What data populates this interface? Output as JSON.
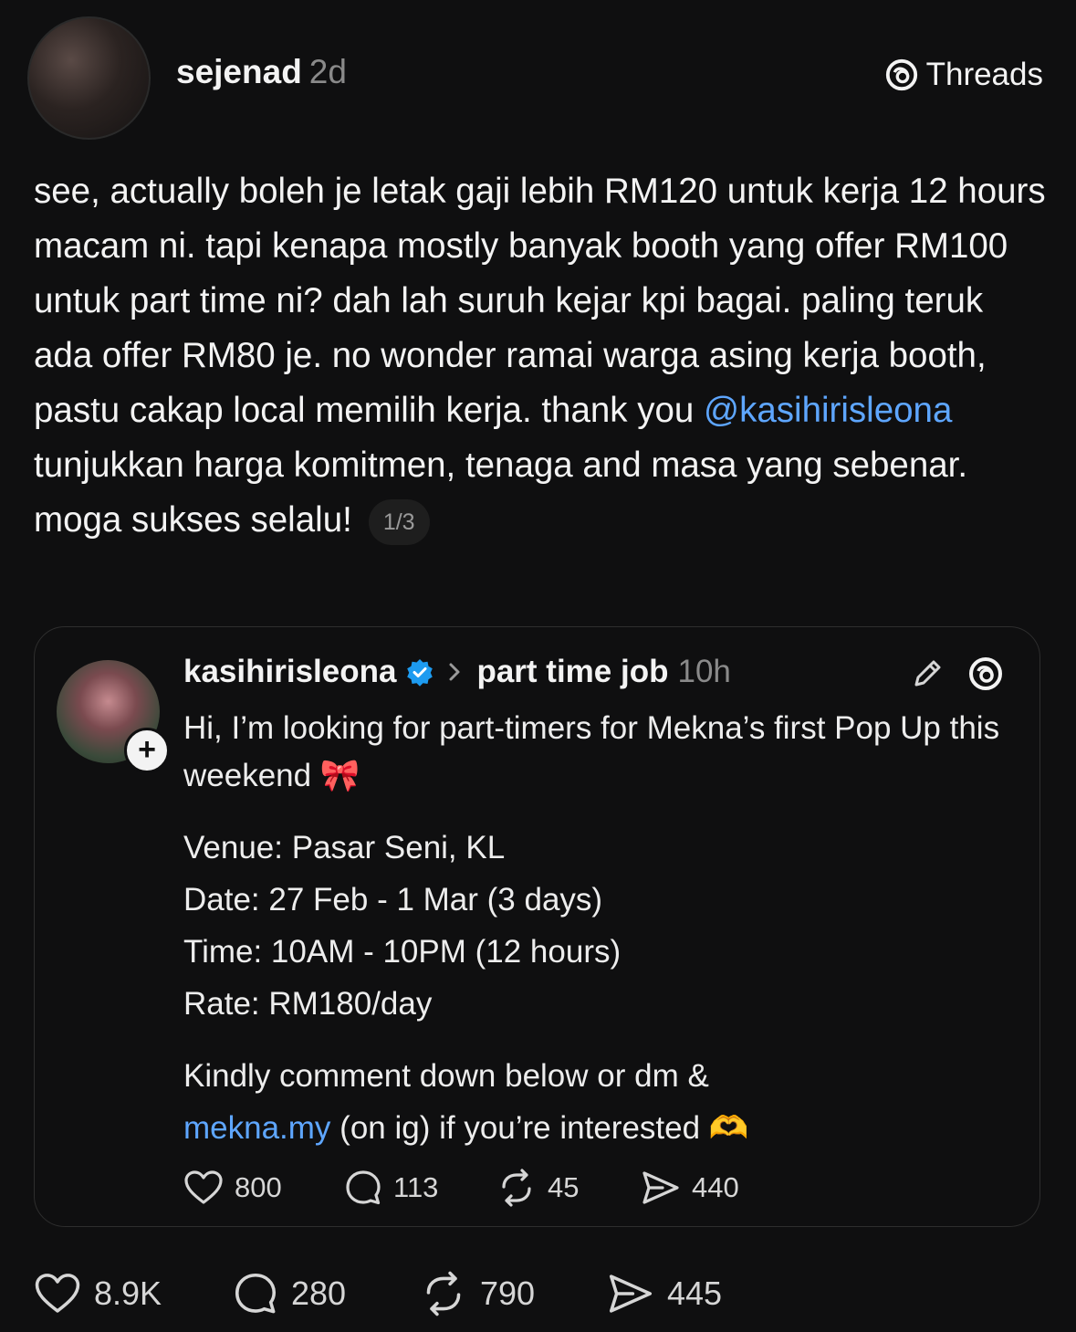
{
  "post": {
    "author": "sejenad",
    "age": "2d",
    "brand": "Threads",
    "text_before_mention": "see, actually boleh je letak gaji lebih RM120 untuk kerja 12 hours macam ni. tapi kenapa mostly banyak booth yang offer RM100 untuk part time ni? dah lah suruh kejar kpi bagai. paling teruk ada offer RM80 je. no wonder ramai warga asing kerja booth, pastu cakap local memilih kerja. thank you ",
    "mention": "@kasihirisleona",
    "text_after_mention": " tunjukkan harga komitmen, tenaga and masa yang sebenar. moga sukses selalu!",
    "pager": "1/3",
    "actions": {
      "likes": "8.9K",
      "replies": "280",
      "reposts": "790",
      "shares": "445"
    }
  },
  "quoted": {
    "author": "kasihirisleona",
    "topic": "part time job",
    "age": "10h",
    "intro": "Hi, I’m looking for part-timers for Mekna’s first Pop Up this weekend 🎀",
    "details": [
      "Venue: Pasar Seni, KL",
      "Date: 27 Feb - 1 Mar (3 days)",
      "Time: 10AM - 10PM (12 hours)",
      "Rate: RM180/day"
    ],
    "cta_line1": "Kindly comment down below or dm &",
    "cta_link": "mekna.my",
    "cta_rest": " (on ig) if you’re interested 🫶",
    "actions": {
      "likes": "800",
      "replies": "113",
      "reposts": "45",
      "shares": "440"
    }
  },
  "colors": {
    "background": "#0f0f10",
    "text": "#f3f3f3",
    "muted": "#8a8a8a",
    "link": "#5ea6ff",
    "verified": "#1d9bf0"
  },
  "icons": [
    "threads-logo-icon",
    "verified-badge-icon",
    "chevron-right-icon",
    "edit-pencil-icon",
    "threads-logo-icon",
    "heart-icon",
    "comment-icon",
    "repost-icon",
    "share-icon"
  ]
}
